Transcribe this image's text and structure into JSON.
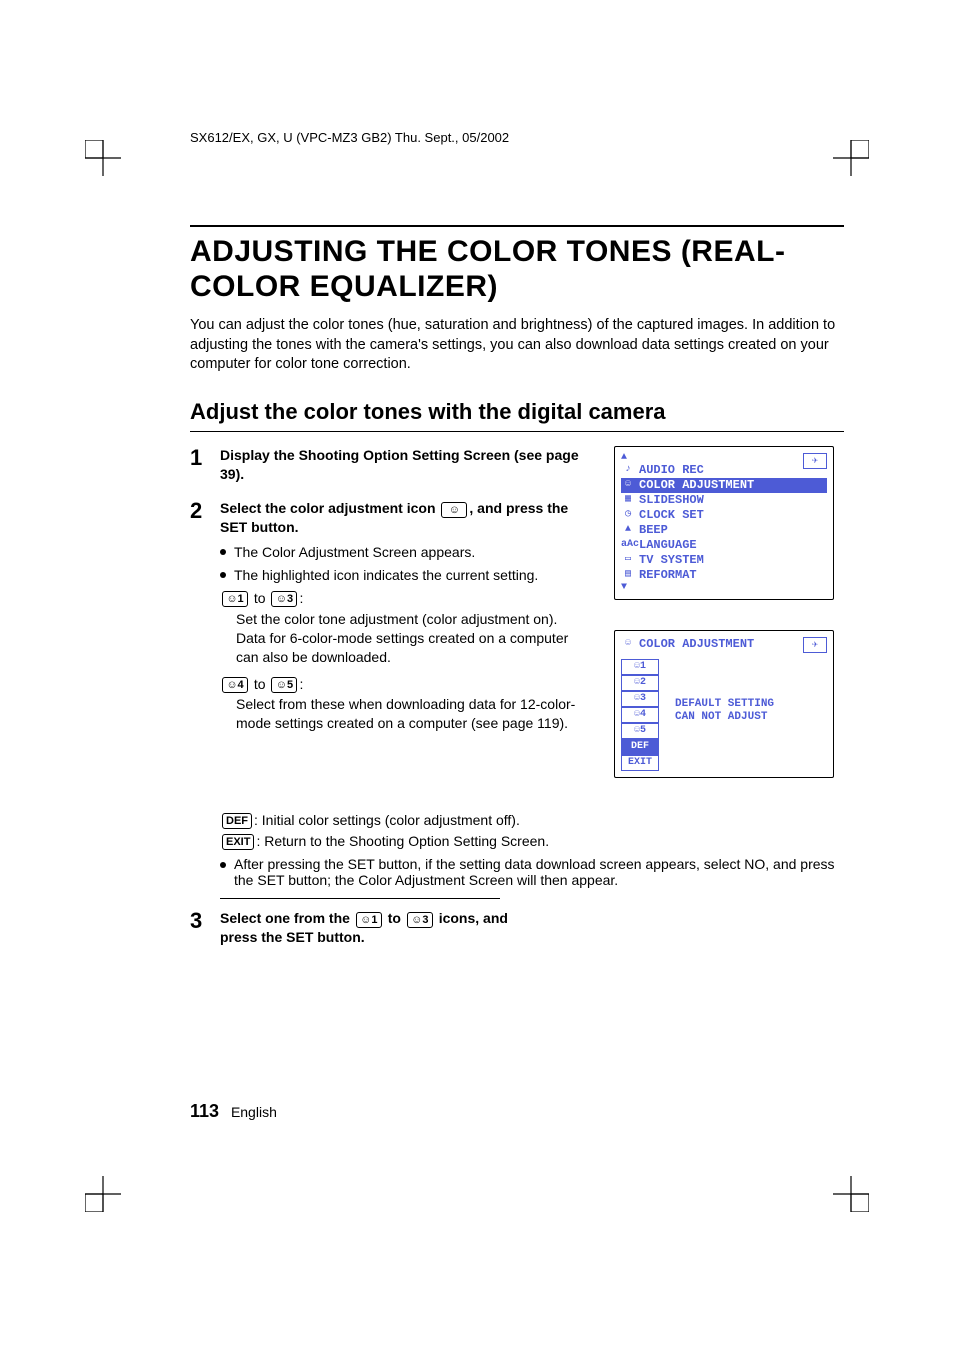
{
  "header": "SX612/EX, GX, U (VPC-MZ3 GB2)    Thu. Sept., 05/2002",
  "title": "ADJUSTING THE COLOR TONES (REAL-COLOR EQUALIZER)",
  "intro": "You can adjust the color tones (hue, saturation and brightness) of the captured images. In addition to adjusting the tones with the camera's settings, you can also download data settings created on your computer for color tone correction.",
  "subtitle": "Adjust the color tones with the digital camera",
  "steps": {
    "s1": {
      "num": "1",
      "title": "Display the Shooting Option Setting Screen (see page 39)."
    },
    "s2": {
      "num": "2",
      "title_pre": "Select the color adjustment icon ",
      "title_post": ", and press the SET button.",
      "b1": "The Color Adjustment Screen appears.",
      "b2": "The highlighted icon indicates the current setting.",
      "range1_to": " to ",
      "range1_desc": "Set the color tone adjustment (color adjustment on). Data for 6-color-mode settings created on a computer can also be downloaded.",
      "range2_to": " to ",
      "range2_desc": "Select from these when downloading data for 12-color-mode settings created on a computer (see page 119).",
      "def_label": "DEF",
      "def_text": ": Initial color settings (color adjustment off).",
      "exit_label": "EXIT",
      "exit_text": ": Return to the Shooting Option Setting Screen.",
      "b3": "After pressing the SET button, if the setting data download screen appears, select NO, and press the SET button; the Color Adjustment Screen will then appear."
    },
    "s3": {
      "num": "3",
      "title_pre": "Select one from the ",
      "title_mid": " to ",
      "title_post": " icons, and press the SET button."
    }
  },
  "icons": {
    "palette": "☺",
    "p1": "☺1",
    "p2": "☺2",
    "p3": "☺3",
    "p4": "☺4",
    "p5": "☺5"
  },
  "screen1": {
    "items": [
      {
        "icon": "♪",
        "label": "AUDIO REC"
      },
      {
        "icon": "☺",
        "label": "COLOR ADJUSTMENT",
        "selected": true
      },
      {
        "icon": "▦",
        "label": "SLIDESHOW"
      },
      {
        "icon": "◷",
        "label": "CLOCK SET"
      },
      {
        "icon": "▲",
        "label": "BEEP"
      },
      {
        "icon": "aAc",
        "label": "LANGUAGE"
      },
      {
        "icon": "▭",
        "label": "TV SYSTEM"
      },
      {
        "icon": "▤",
        "label": "REFORMAT"
      }
    ]
  },
  "screen2": {
    "title": "COLOR ADJUSTMENT",
    "options": [
      "☺1",
      "☺2",
      "☺3",
      "☺4",
      "☺5",
      "DEF",
      "EXIT"
    ],
    "selected_index": 5,
    "msg1": "DEFAULT SETTING",
    "msg2": "CAN NOT ADJUST"
  },
  "footer": {
    "page": "113",
    "lang": "English"
  }
}
